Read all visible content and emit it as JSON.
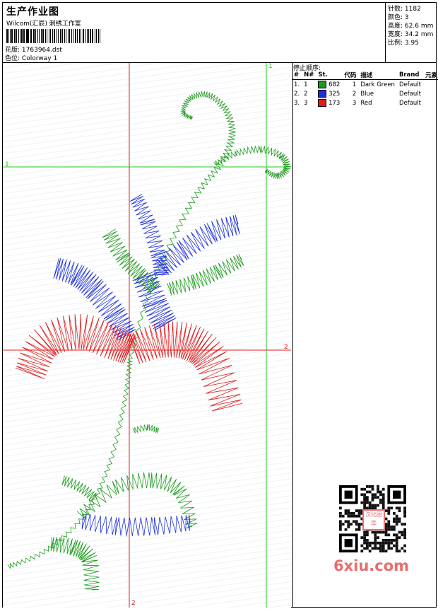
{
  "header": {
    "title": "生产作业图",
    "company": "Wilcom(汇辰) 刺绣工作室",
    "design_label": "花版:",
    "design_value": "1763964.dst",
    "colorway_label": "色位:",
    "colorway_value": "Colorway 1"
  },
  "stats": {
    "stitches_label": "针数:",
    "stitches_value": "1182",
    "colors_label": "颜色:",
    "colors_value": "3",
    "height_label": "高度:",
    "height_value": "62.6 mm",
    "width_label": "宽度:",
    "width_value": "34.2 mm",
    "scale_label": "比例:",
    "scale_value": "3.95"
  },
  "sequence": {
    "title": "停止顺序:",
    "headers": [
      "#",
      "N#",
      "St.",
      "代码",
      "描述",
      "Brand",
      "元素"
    ],
    "rows": [
      {
        "num": "1.",
        "n": "1",
        "stitches": "682",
        "code": "1",
        "desc": "Dark Green",
        "brand": "Default",
        "color": "#1a9a1a"
      },
      {
        "num": "2.",
        "n": "2",
        "stitches": "325",
        "code": "2",
        "desc": "Blue",
        "brand": "Default",
        "color": "#1c2fe0"
      },
      {
        "num": "3.",
        "n": "3",
        "stitches": "173",
        "code": "3",
        "desc": "Red",
        "brand": "Default",
        "color": "#e01c1c"
      }
    ]
  },
  "guides": {
    "v1_label": "1",
    "h1_label": "1",
    "h2_label": "2",
    "v2_label": "2"
  },
  "colors": {
    "green": "#1a9a1a",
    "blue": "#1c2fe0",
    "red": "#e01c1c",
    "guide_green": "#22cc22",
    "guide_red": "#dd2222"
  },
  "watermark": {
    "qr_stamp": "汉化图库",
    "brand": "6xiu.com"
  }
}
